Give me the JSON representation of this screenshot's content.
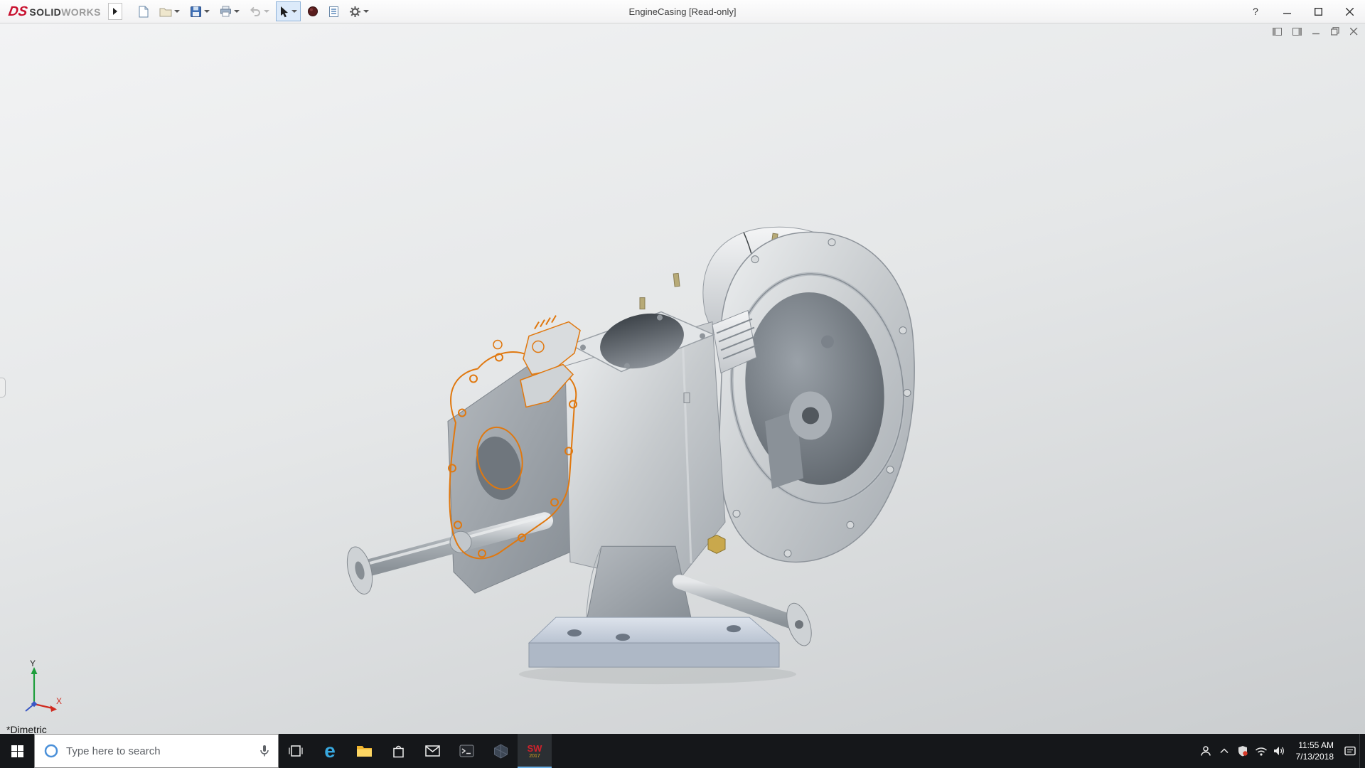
{
  "titlebar": {
    "logo": {
      "ds": "DS",
      "solid": "SOLID",
      "works": "WORKS"
    },
    "document_title": "EngineCasing [Read-only]",
    "help_glyph": "?"
  },
  "toolbar": {
    "icons": [
      "flyout-expand",
      "new-document",
      "open",
      "save",
      "print",
      "undo",
      "select",
      "rebuild",
      "file-properties",
      "options"
    ]
  },
  "viewport": {
    "view_label": "*Dimetric",
    "triad": {
      "x": "X",
      "y": "Y"
    }
  },
  "model": {
    "highlight_color": "#e0780f",
    "metal_color": "#c6cacd",
    "base_color": "#b9c3d1"
  },
  "taskbar": {
    "search_placeholder": "Type here to search",
    "edge_letter": "e",
    "solidworks_badge": {
      "letters": "SW",
      "year": "2017"
    },
    "clock": {
      "time": "11:55 AM",
      "date": "7/13/2018"
    },
    "apps": [
      "start",
      "search",
      "task-view",
      "edge",
      "file-explorer",
      "store",
      "mail",
      "terminal",
      "edrawings",
      "solidworks"
    ],
    "tray": [
      "people",
      "show-hidden-icons",
      "antivirus",
      "network",
      "volume",
      "clock",
      "action-center",
      "show-desktop"
    ]
  }
}
